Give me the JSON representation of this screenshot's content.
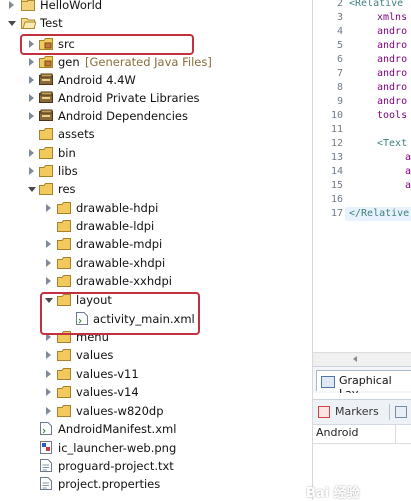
{
  "tree": {
    "items": [
      {
        "label": "HelloWorld",
        "icon": "project-closed-icon"
      },
      {
        "label": "Test",
        "icon": "project-open-icon"
      },
      {
        "label": "src",
        "icon": "package-folder-icon"
      },
      {
        "label": "gen",
        "decoration": "[Generated Java Files]",
        "icon": "package-folder-icon"
      },
      {
        "label": "Android 4.4W",
        "icon": "library-icon"
      },
      {
        "label": "Android Private Libraries",
        "icon": "library-icon"
      },
      {
        "label": "Android Dependencies",
        "icon": "library-icon"
      },
      {
        "label": "assets",
        "icon": "folder-icon"
      },
      {
        "label": "bin",
        "icon": "folder-icon"
      },
      {
        "label": "libs",
        "icon": "folder-icon"
      },
      {
        "label": "res",
        "icon": "folder-icon"
      },
      {
        "label": "drawable-hdpi",
        "icon": "folder-icon"
      },
      {
        "label": "drawable-ldpi",
        "icon": "folder-icon"
      },
      {
        "label": "drawable-mdpi",
        "icon": "folder-icon"
      },
      {
        "label": "drawable-xhdpi",
        "icon": "folder-icon"
      },
      {
        "label": "drawable-xxhdpi",
        "icon": "folder-icon"
      },
      {
        "label": "layout",
        "icon": "folder-icon"
      },
      {
        "label": "activity_main.xml",
        "icon": "xml-file-icon"
      },
      {
        "label": "menu",
        "icon": "folder-icon"
      },
      {
        "label": "values",
        "icon": "folder-icon"
      },
      {
        "label": "values-v11",
        "icon": "folder-icon"
      },
      {
        "label": "values-v14",
        "icon": "folder-icon"
      },
      {
        "label": "values-w820dp",
        "icon": "folder-icon"
      },
      {
        "label": "AndroidManifest.xml",
        "icon": "xml-file-icon"
      },
      {
        "label": "ic_launcher-web.png",
        "icon": "image-file-icon"
      },
      {
        "label": "proguard-project.txt",
        "icon": "text-file-icon"
      },
      {
        "label": "project.properties",
        "icon": "text-file-icon"
      }
    ]
  },
  "editor": {
    "line_numbers": [
      "2",
      "3",
      "4",
      "5",
      "6",
      "7",
      "8",
      "9",
      "10",
      "11",
      "12",
      "13",
      "14",
      "15",
      "16",
      "17"
    ],
    "lines": [
      "<Relative",
      "xmlns",
      "andro",
      "andro",
      "andro",
      "andro",
      "andro",
      "andro",
      "tools",
      "",
      "<Text",
      "a",
      "a",
      "a",
      "",
      "</Relative",
      ""
    ]
  },
  "bottom": {
    "graphical_tab": "Graphical Lay",
    "markers_tab": "Markers",
    "column_header": "Android"
  },
  "watermark": "Bai 经验",
  "colors": {
    "highlight_box": "#c3303f",
    "tree_folder": "#e8b84a"
  }
}
